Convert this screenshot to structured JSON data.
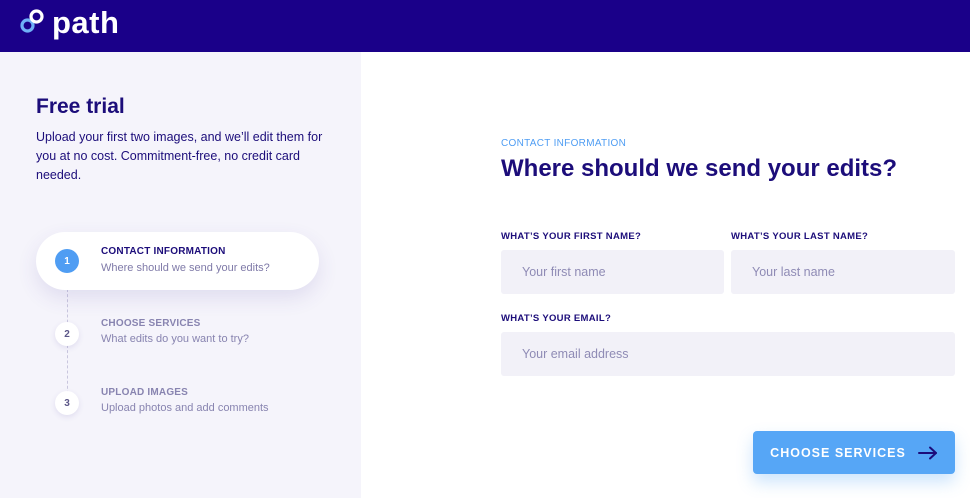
{
  "header": {
    "logo_text": "path",
    "logo_icon": "infinity-link-icon",
    "background": "#1a0089"
  },
  "sidebar": {
    "title": "Free trial",
    "description": "Upload your first two images, and we’ll edit them for you at no cost. Commitment-free, no credit card needed.",
    "steps": [
      {
        "number": "1",
        "title": "CONTACT INFORMATION",
        "subtitle": "Where should we send your edits?",
        "active": true
      },
      {
        "number": "2",
        "title": "CHOOSE SERVICES",
        "subtitle": "What edits do you want to try?",
        "active": false
      },
      {
        "number": "3",
        "title": "UPLOAD IMAGES",
        "subtitle": "Upload photos and add comments",
        "active": false
      }
    ]
  },
  "form": {
    "eyebrow": "CONTACT INFORMATION",
    "heading": "Where should we send your edits?",
    "first_name": {
      "label": "WHAT’S YOUR FIRST NAME?",
      "placeholder": "Your first name",
      "value": ""
    },
    "last_name": {
      "label": "WHAT’S YOUR LAST NAME?",
      "placeholder": "Your last name",
      "value": ""
    },
    "email": {
      "label": "WHAT’S YOUR EMAIL?",
      "placeholder": "Your email address",
      "value": ""
    },
    "submit_label": "CHOOSE SERVICES",
    "submit_icon": "arrow-right-icon"
  },
  "colors": {
    "brand_dark": "#1c0d7a",
    "accent": "#56a6f6",
    "panel_bg": "#f5f4fb",
    "input_bg": "#f2f1f8"
  }
}
